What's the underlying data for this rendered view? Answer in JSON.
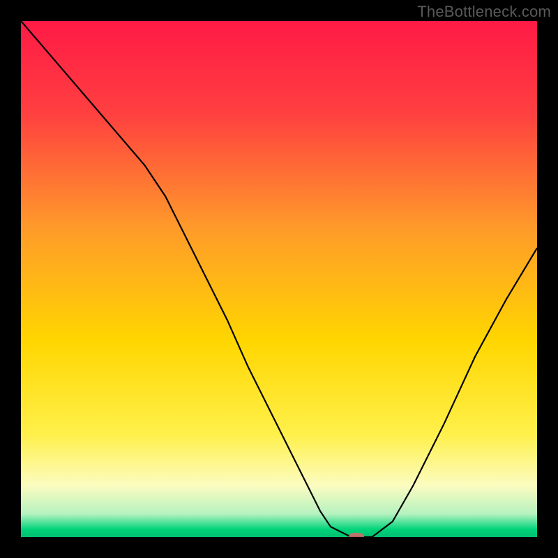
{
  "watermark": "TheBottleneck.com",
  "chart_data": {
    "type": "line",
    "title": "",
    "xlabel": "",
    "ylabel": "",
    "xlim": [
      0,
      100
    ],
    "ylim": [
      0,
      100
    ],
    "background_gradient": {
      "stops": [
        {
          "pos": 0.0,
          "color": "#ff1a46"
        },
        {
          "pos": 0.18,
          "color": "#ff4040"
        },
        {
          "pos": 0.4,
          "color": "#ff9a2a"
        },
        {
          "pos": 0.62,
          "color": "#ffd600"
        },
        {
          "pos": 0.8,
          "color": "#fff04a"
        },
        {
          "pos": 0.9,
          "color": "#fcfcc0"
        },
        {
          "pos": 0.955,
          "color": "#b6f2c0"
        },
        {
          "pos": 0.985,
          "color": "#00d47a"
        },
        {
          "pos": 1.0,
          "color": "#00c070"
        }
      ]
    },
    "series": [
      {
        "name": "bottleneck-curve",
        "color": "#000000",
        "x": [
          0,
          6,
          12,
          18,
          24,
          28,
          32,
          36,
          40,
          44,
          48,
          52,
          56,
          58,
          60,
          62,
          64,
          68,
          72,
          76,
          82,
          88,
          94,
          100
        ],
        "y": [
          100,
          93,
          86,
          79,
          72,
          66,
          58,
          50,
          42,
          33,
          25,
          17,
          9,
          5,
          2,
          1,
          0,
          0,
          3,
          10,
          22,
          35,
          46,
          56
        ]
      }
    ],
    "marker": {
      "x": 65,
      "y": 0,
      "color": "#d76a6a"
    }
  }
}
